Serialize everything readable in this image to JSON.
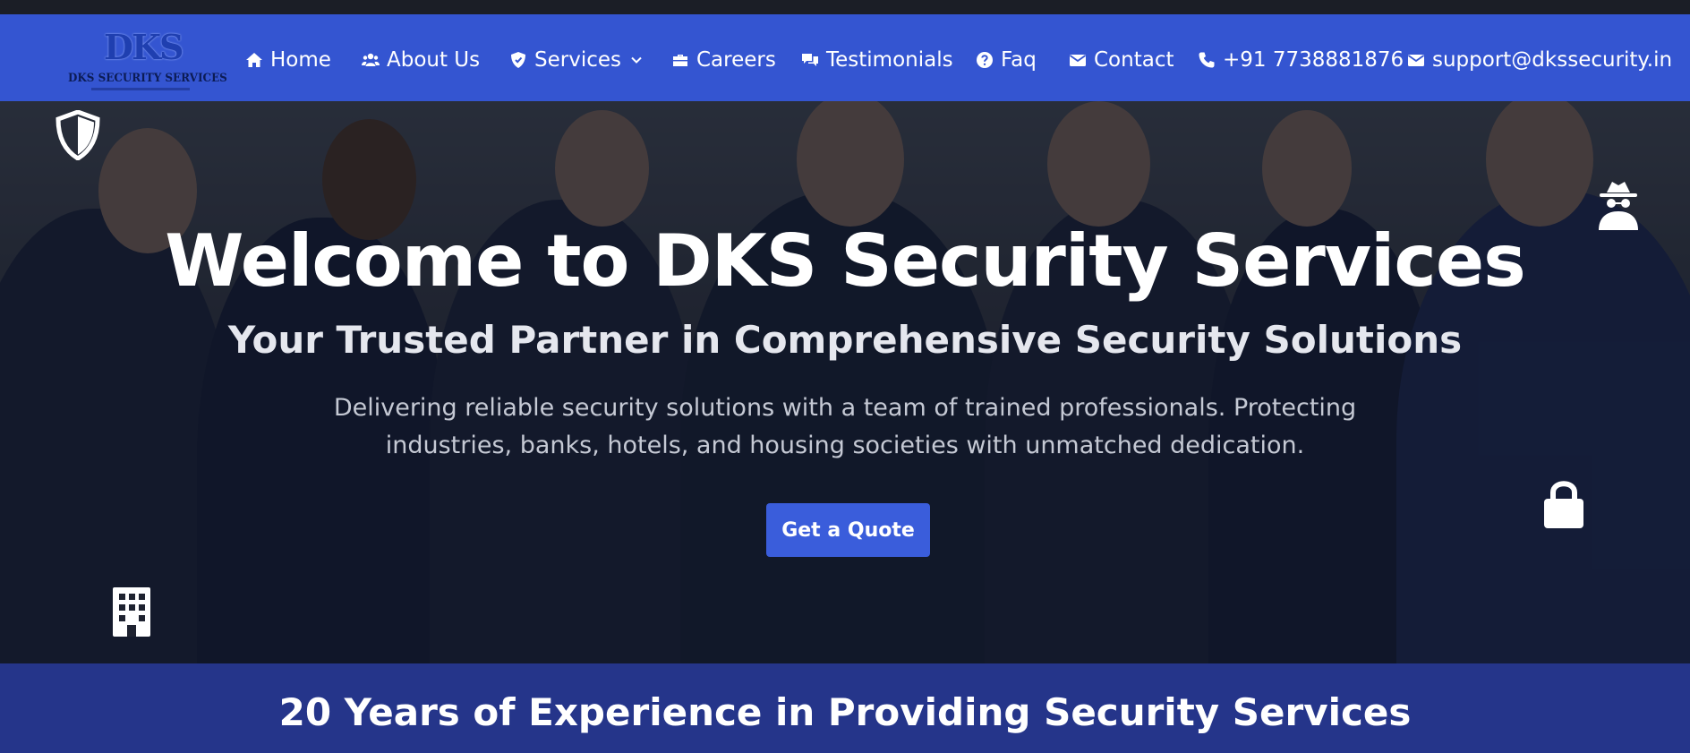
{
  "brand": {
    "logo_mark": "DKS",
    "name": "DKS SECURITY SERVICES",
    "color": "#3455d1"
  },
  "nav": {
    "items": [
      {
        "label": "Home",
        "icon": "home-icon"
      },
      {
        "label": "About Us",
        "icon": "users-icon"
      },
      {
        "label": "Services",
        "icon": "shield-icon"
      },
      {
        "label": "Careers",
        "icon": "briefcase-icon"
      },
      {
        "label": "Testimonials",
        "icon": "comments-icon"
      },
      {
        "label": "Faq",
        "icon": "question-circle-icon"
      },
      {
        "label": "Contact",
        "icon": "envelope-icon"
      },
      {
        "label": "+91 7738881876",
        "icon": "phone-icon"
      },
      {
        "label": "support@dkssecurity.in",
        "icon": "envelope-icon"
      }
    ]
  },
  "hero": {
    "title": "Welcome to DKS Security Services",
    "subtitle": "Your Trusted Partner in Comprehensive Security Solutions",
    "description": "Delivering reliable security solutions with a team of trained professionals. Protecting industries, banks, hotels, and housing societies with unmatched dedication.",
    "cta_label": "Get a Quote",
    "floating_icons": [
      "shield-icon",
      "spy-icon",
      "lock-icon",
      "building-icon"
    ]
  },
  "banner": {
    "text": "20 Years of Experience in Providing Security Services",
    "color": "#25358a"
  }
}
